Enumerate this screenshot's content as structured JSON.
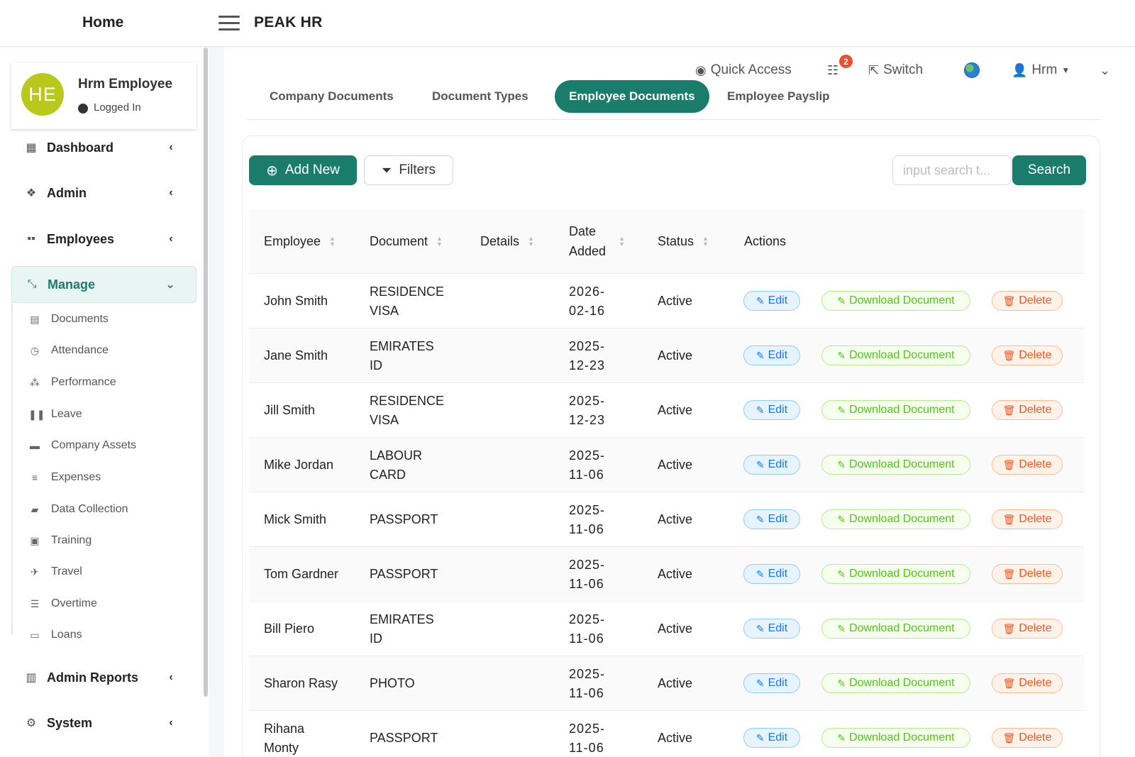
{
  "header": {
    "home_label": "Home",
    "app_title": "PEAK HR"
  },
  "profile": {
    "initials": "HE",
    "name": "Hrm Employee",
    "status": "Logged In"
  },
  "sidebar": {
    "items": [
      {
        "label": "Dashboard",
        "icon": "grid-icon"
      },
      {
        "label": "Admin",
        "icon": "cubes-icon"
      },
      {
        "label": "Employees",
        "icon": "users-grid-icon"
      },
      {
        "label": "Manage",
        "icon": "compress-icon"
      }
    ],
    "manage_sub": [
      {
        "label": "Documents",
        "icon": "file-icon"
      },
      {
        "label": "Attendance",
        "icon": "clock-icon"
      },
      {
        "label": "Performance",
        "icon": "network-icon"
      },
      {
        "label": "Leave",
        "icon": "pause-icon"
      },
      {
        "label": "Company Assets",
        "icon": "archive-icon"
      },
      {
        "label": "Expenses",
        "icon": "list-icon"
      },
      {
        "label": "Data Collection",
        "icon": "folder-icon"
      },
      {
        "label": "Training",
        "icon": "briefcase-icon"
      },
      {
        "label": "Travel",
        "icon": "plane-icon"
      },
      {
        "label": "Overtime",
        "icon": "align-icon"
      },
      {
        "label": "Loans",
        "icon": "card-icon"
      }
    ],
    "bottom": [
      {
        "label": "Admin Reports",
        "icon": "book-icon"
      },
      {
        "label": "System",
        "icon": "cogs-icon"
      }
    ]
  },
  "utility": {
    "quick_access": "Quick Access",
    "tasks_badge": "2",
    "switch": "Switch",
    "user": "Hrm"
  },
  "tabs": [
    "Company Documents",
    "Document Types",
    "Employee Documents",
    "Employee Payslip"
  ],
  "toolbar": {
    "add_new": "Add New",
    "filters": "Filters",
    "search_placeholder": "input search t...",
    "search_button": "Search"
  },
  "table": {
    "columns": {
      "employee": "Employee",
      "document": "Document",
      "details": "Details",
      "date_1": "Date",
      "date_2": "Added",
      "status": "Status",
      "actions": "Actions"
    },
    "action_labels": {
      "edit": "Edit",
      "download": "Download Document",
      "delete": "Delete"
    },
    "rows": [
      {
        "employee": "John Smith",
        "document": "RESIDENCE VISA",
        "date_1": "2026-",
        "date_2": "02-16",
        "status": "Active"
      },
      {
        "employee": "Jane Smith",
        "document": "EMIRATES ID",
        "date_1": "2025-",
        "date_2": "12-23",
        "status": "Active"
      },
      {
        "employee": "Jill Smith",
        "document": "RESIDENCE VISA",
        "date_1": "2025-",
        "date_2": "12-23",
        "status": "Active"
      },
      {
        "employee": "Mike Jordan",
        "document": "LABOUR CARD",
        "date_1": "2025-",
        "date_2": "11-06",
        "status": "Active"
      },
      {
        "employee": "Mick Smith",
        "document": "PASSPORT",
        "date_1": "2025-",
        "date_2": "11-06",
        "status": "Active"
      },
      {
        "employee": "Tom Gardner",
        "document": "PASSPORT",
        "date_1": "2025-",
        "date_2": "11-06",
        "status": "Active"
      },
      {
        "employee": "Bill Piero",
        "document": "EMIRATES ID",
        "date_1": "2025-",
        "date_2": "11-06",
        "status": "Active"
      },
      {
        "employee": "Sharon Rasy",
        "document": "PHOTO",
        "date_1": "2025-",
        "date_2": "11-06",
        "status": "Active"
      },
      {
        "employee": "Rihana Monty",
        "document": "PASSPORT",
        "date_1": "2025-",
        "date_2": "11-06",
        "status": "Active"
      }
    ]
  },
  "colors": {
    "primary": "#1a7d6c",
    "badge": "#ef4f2c",
    "avatar": "#b8c91c"
  }
}
